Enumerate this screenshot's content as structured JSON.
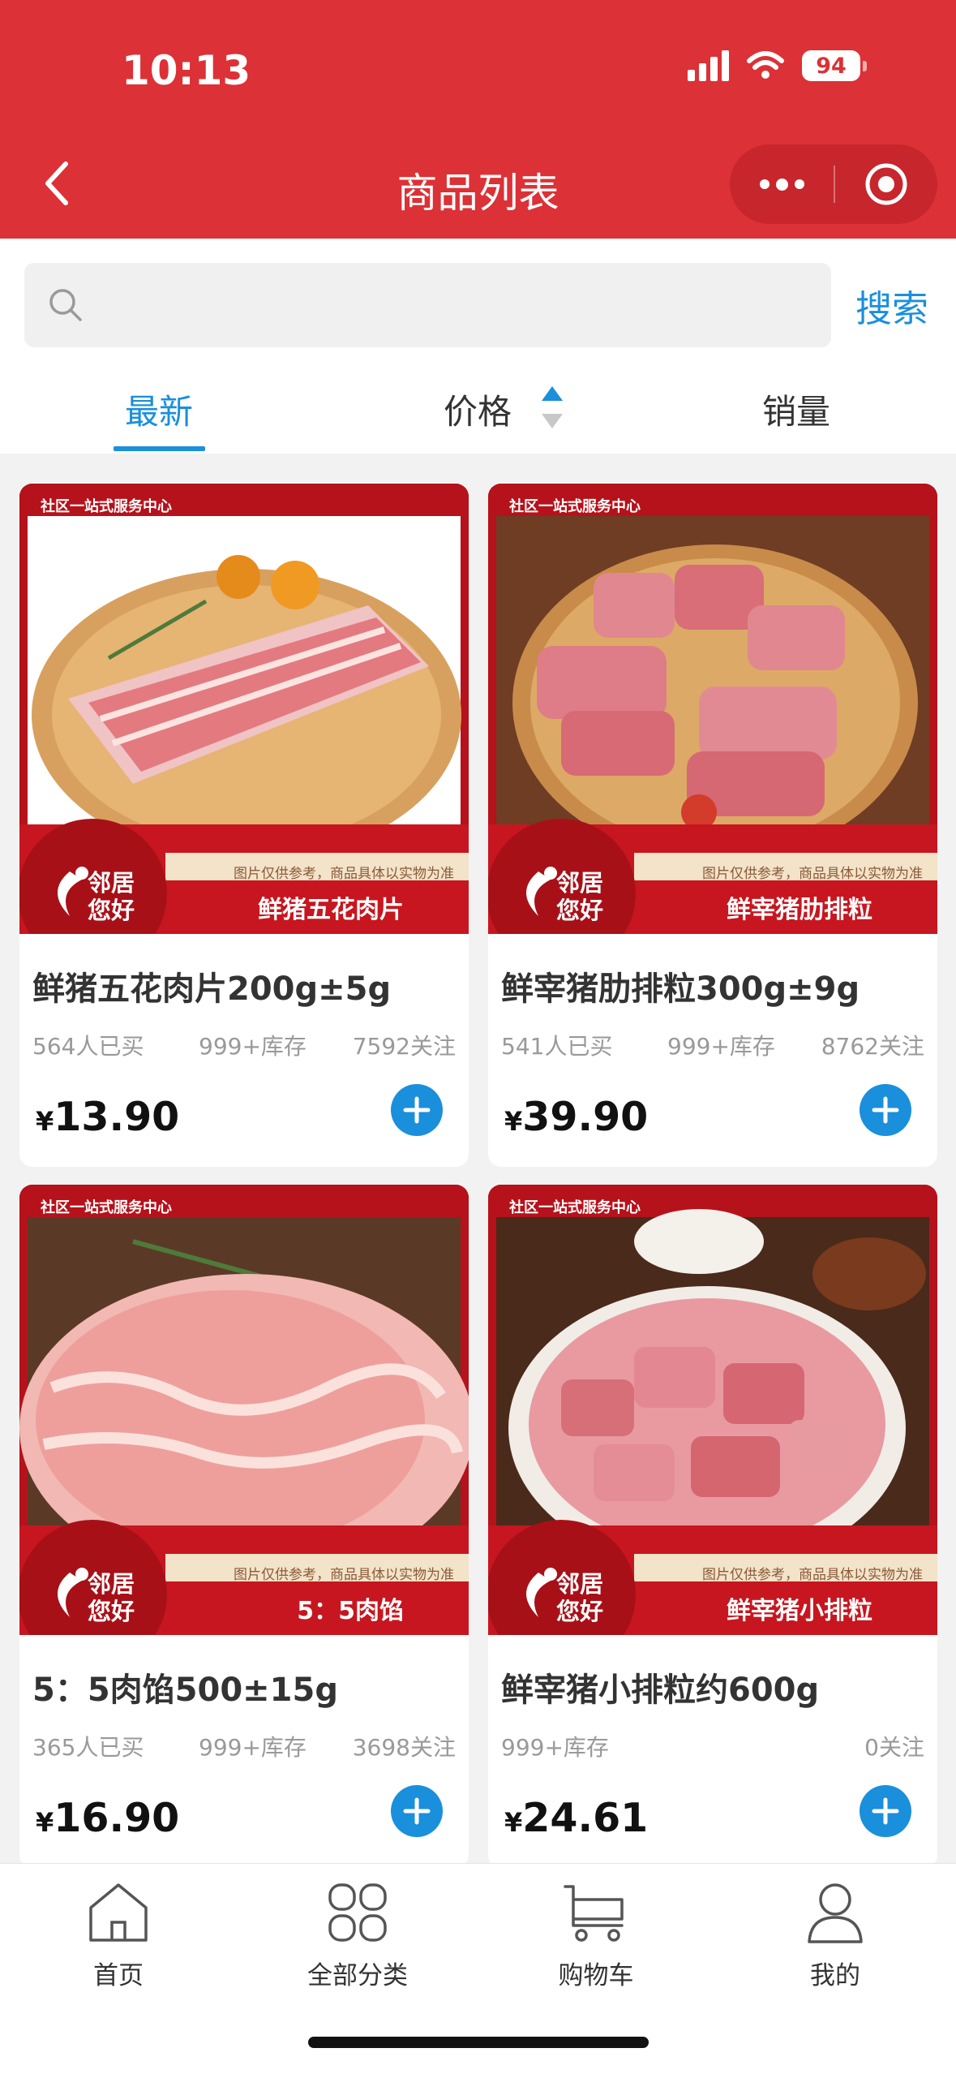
{
  "status_bar": {
    "time": "10:13",
    "battery": "94"
  },
  "header": {
    "title": "商品列表"
  },
  "search": {
    "placeholder": "",
    "button_label": "搜索"
  },
  "tabs": [
    {
      "label": "最新",
      "active": true
    },
    {
      "label": "价格",
      "active": false
    },
    {
      "label": "销量",
      "active": false
    }
  ],
  "products": [
    {
      "image_badge": "社区一站式服务中心",
      "image_note": "图片仅供参考，商品具体以实物为准",
      "brand_line1": "邻居",
      "brand_line2": "您好",
      "image_label": "鲜猪五花肉片",
      "title": "鲜猪五花肉片200g±5g",
      "bought": "564人已买",
      "stock": "999+库存",
      "followers": "7592关注",
      "currency": "¥",
      "price": "13.90"
    },
    {
      "image_badge": "社区一站式服务中心",
      "image_note": "图片仅供参考，商品具体以实物为准",
      "brand_line1": "邻居",
      "brand_line2": "您好",
      "image_label": "鲜宰猪肋排粒",
      "title": "鲜宰猪肋排粒300g±9g",
      "bought": "541人已买",
      "stock": "999+库存",
      "followers": "8762关注",
      "currency": "¥",
      "price": "39.90"
    },
    {
      "image_badge": "社区一站式服务中心",
      "image_note": "图片仅供参考，商品具体以实物为准",
      "brand_line1": "邻居",
      "brand_line2": "您好",
      "image_label": "5：5肉馅",
      "title": "5：5肉馅500±15g",
      "bought": "365人已买",
      "stock": "999+库存",
      "followers": "3698关注",
      "currency": "¥",
      "price": "16.90"
    },
    {
      "image_badge": "社区一站式服务中心",
      "image_note": "图片仅供参考，商品具体以实物为准",
      "brand_line1": "邻居",
      "brand_line2": "您好",
      "image_label": "鲜宰猪小排粒",
      "title": "鲜宰猪小排粒约600g",
      "bought": "",
      "stock": "999+库存",
      "followers": "0关注",
      "currency": "¥",
      "price": "24.61"
    }
  ],
  "tabbar": [
    {
      "label": "首页",
      "icon": "home-icon"
    },
    {
      "label": "全部分类",
      "icon": "category-icon"
    },
    {
      "label": "购物车",
      "icon": "cart-icon"
    },
    {
      "label": "我的",
      "icon": "profile-icon"
    }
  ],
  "colors": {
    "header": "#dc3136",
    "accent": "#1a8fdc"
  }
}
